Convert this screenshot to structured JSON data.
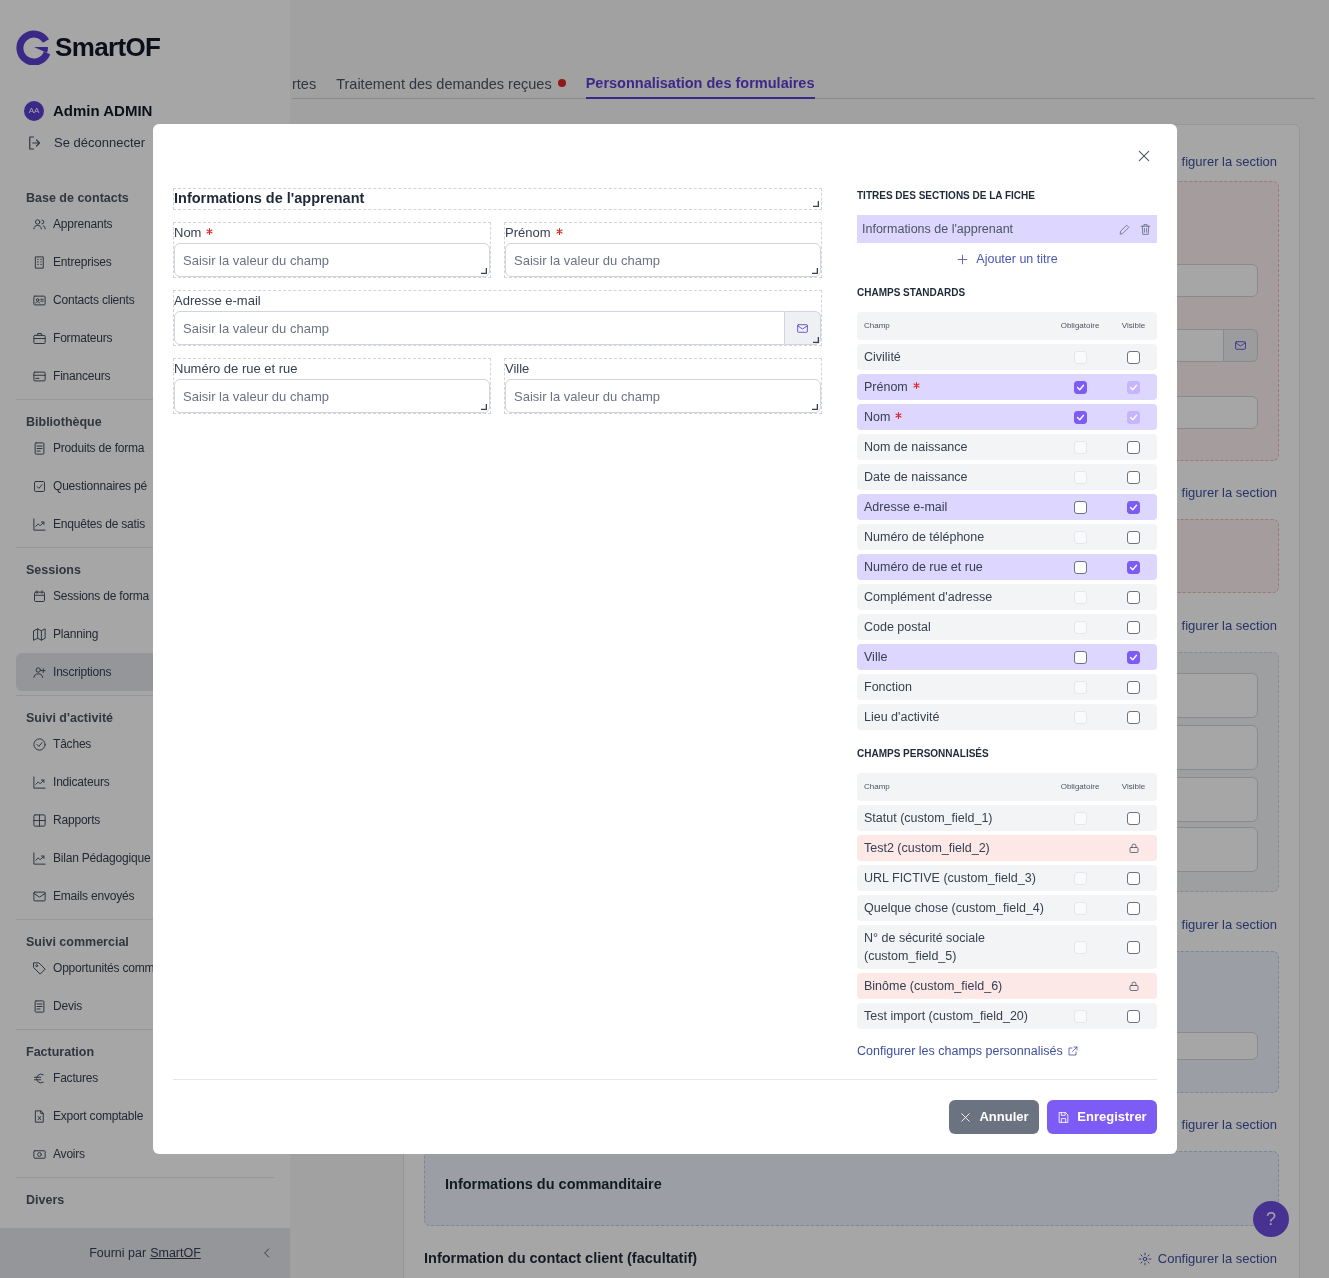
{
  "sidebar": {
    "logo": "SmartOF",
    "user": {
      "initials": "AA",
      "name": "Admin ADMIN"
    },
    "logout": "Se déconnecter",
    "groups": [
      {
        "title": "Base de contacts",
        "items": [
          {
            "label": "Apprenants",
            "selected": false
          },
          {
            "label": "Entreprises",
            "selected": false
          },
          {
            "label": "Contacts clients",
            "selected": false
          },
          {
            "label": "Formateurs",
            "selected": false
          },
          {
            "label": "Financeurs",
            "selected": false
          }
        ]
      },
      {
        "title": "Bibliothèque",
        "items": [
          {
            "label": "Produits de forma",
            "selected": false
          },
          {
            "label": "Questionnaires pé",
            "selected": false
          },
          {
            "label": "Enquêtes de satis",
            "selected": false
          }
        ]
      },
      {
        "title": "Sessions",
        "items": [
          {
            "label": "Sessions de forma",
            "selected": false
          },
          {
            "label": "Planning",
            "selected": false
          },
          {
            "label": "Inscriptions",
            "selected": true
          }
        ]
      },
      {
        "title": "Suivi d'activité",
        "items": [
          {
            "label": "Tâches",
            "selected": false
          },
          {
            "label": "Indicateurs",
            "selected": false
          },
          {
            "label": "Rapports",
            "selected": false
          },
          {
            "label": "Bilan Pédagogique",
            "selected": false
          },
          {
            "label": "Emails envoyés",
            "selected": false
          }
        ]
      },
      {
        "title": "Suivi commercial",
        "items": [
          {
            "label": "Opportunités comm",
            "selected": false
          },
          {
            "label": "Devis",
            "selected": false
          }
        ]
      },
      {
        "title": "Facturation",
        "items": [
          {
            "label": "Factures",
            "selected": false
          },
          {
            "label": "Export comptable",
            "selected": false
          },
          {
            "label": "Avoirs",
            "selected": false
          }
        ]
      },
      {
        "title": "Divers"
      }
    ],
    "footer": {
      "text": "Fourni par",
      "link": "SmartOF"
    }
  },
  "tabs": [
    {
      "label": "rtes",
      "selected": false,
      "notification": false
    },
    {
      "label": "Traitement des demandes reçues",
      "selected": false,
      "notification": true
    },
    {
      "label": "Personnalisation des formulaires",
      "selected": true,
      "notification": false
    }
  ],
  "background": {
    "sections": [
      {
        "link": "figurer la section",
        "kind": "error"
      },
      {
        "link": "figurer la section",
        "kind": "error"
      },
      {
        "link": "figurer la section",
        "kind": "neutral"
      },
      {
        "link": "figurer la section",
        "kind": "info"
      },
      {
        "link": "figurer la section",
        "kind": "info",
        "box_title": "Informations du commanditaire"
      }
    ],
    "last_section": {
      "title": "Information du contact client (facultatif)",
      "link": "Configurer la section"
    },
    "help": "?"
  },
  "modal": {
    "form": {
      "title": "Informations de l'apprenant",
      "fields": [
        {
          "label": "Nom",
          "required": true,
          "placeholder": "Saisir la valeur du champ",
          "kind": "text"
        },
        {
          "label": "Prénom",
          "required": true,
          "placeholder": "Saisir la valeur du champ",
          "kind": "text"
        },
        {
          "label": "Adresse e-mail",
          "required": false,
          "placeholder": "Saisir la valeur du champ",
          "kind": "email"
        },
        {
          "label": "Numéro de rue et rue",
          "required": false,
          "placeholder": "Saisir la valeur du champ",
          "kind": "text"
        },
        {
          "label": "Ville",
          "required": false,
          "placeholder": "Saisir la valeur du champ",
          "kind": "text"
        }
      ]
    },
    "titles_heading": "TITRES DES SECTIONS DE LA FICHE",
    "section_titles": [
      "Informations de l'apprenant"
    ],
    "add_title": "Ajouter un titre",
    "standard": {
      "heading": "CHAMPS STANDARDS",
      "columns": [
        "Champ",
        "Obligatoire",
        "Visible"
      ],
      "rows": [
        {
          "label": "Civilité",
          "required": false,
          "selected": false,
          "mandatory": {
            "checked": false,
            "disabled": true
          },
          "visible": {
            "checked": false,
            "disabled": false
          }
        },
        {
          "label": "Prénom",
          "required": true,
          "selected": true,
          "mandatory": {
            "checked": true,
            "disabled": false
          },
          "visible": {
            "checked": true,
            "disabled": true
          }
        },
        {
          "label": "Nom",
          "required": true,
          "selected": true,
          "mandatory": {
            "checked": true,
            "disabled": false
          },
          "visible": {
            "checked": true,
            "disabled": true
          }
        },
        {
          "label": "Nom de naissance",
          "required": false,
          "selected": false,
          "mandatory": {
            "checked": false,
            "disabled": true
          },
          "visible": {
            "checked": false,
            "disabled": false
          }
        },
        {
          "label": "Date de naissance",
          "required": false,
          "selected": false,
          "mandatory": {
            "checked": false,
            "disabled": true
          },
          "visible": {
            "checked": false,
            "disabled": false
          }
        },
        {
          "label": "Adresse e-mail",
          "required": false,
          "selected": true,
          "mandatory": {
            "checked": false,
            "disabled": false
          },
          "visible": {
            "checked": true,
            "disabled": false
          }
        },
        {
          "label": "Numéro de téléphone",
          "required": false,
          "selected": false,
          "mandatory": {
            "checked": false,
            "disabled": true
          },
          "visible": {
            "checked": false,
            "disabled": false
          }
        },
        {
          "label": "Numéro de rue et rue",
          "required": false,
          "selected": true,
          "mandatory": {
            "checked": false,
            "disabled": false
          },
          "visible": {
            "checked": true,
            "disabled": false
          }
        },
        {
          "label": "Complément d'adresse",
          "required": false,
          "selected": false,
          "mandatory": {
            "checked": false,
            "disabled": true
          },
          "visible": {
            "checked": false,
            "disabled": false
          }
        },
        {
          "label": "Code postal",
          "required": false,
          "selected": false,
          "mandatory": {
            "checked": false,
            "disabled": true
          },
          "visible": {
            "checked": false,
            "disabled": false
          }
        },
        {
          "label": "Ville",
          "required": false,
          "selected": true,
          "mandatory": {
            "checked": false,
            "disabled": false
          },
          "visible": {
            "checked": true,
            "disabled": false
          }
        },
        {
          "label": "Fonction",
          "required": false,
          "selected": false,
          "mandatory": {
            "checked": false,
            "disabled": true
          },
          "visible": {
            "checked": false,
            "disabled": false
          }
        },
        {
          "label": "Lieu d'activité",
          "required": false,
          "selected": false,
          "mandatory": {
            "checked": false,
            "disabled": true
          },
          "visible": {
            "checked": false,
            "disabled": false
          }
        }
      ]
    },
    "custom": {
      "heading": "CHAMPS PERSONNALISÉS",
      "columns": [
        "Champ",
        "Obligatoire",
        "Visible"
      ],
      "rows": [
        {
          "label": "Statut (custom_field_1)",
          "kind": "checkbox",
          "mandatory": {
            "checked": false,
            "disabled": true
          },
          "visible": {
            "checked": false,
            "disabled": false
          }
        },
        {
          "label": "Test2 (custom_field_2)",
          "kind": "locked"
        },
        {
          "label": "URL FICTIVE (custom_field_3)",
          "kind": "checkbox",
          "mandatory": {
            "checked": false,
            "disabled": true
          },
          "visible": {
            "checked": false,
            "disabled": false
          }
        },
        {
          "label": "Quelque chose (custom_field_4)",
          "kind": "checkbox",
          "mandatory": {
            "checked": false,
            "disabled": true
          },
          "visible": {
            "checked": false,
            "disabled": false
          }
        },
        {
          "label": "N° de sécurité sociale (custom_field_5)",
          "kind": "checkbox",
          "mandatory": {
            "checked": false,
            "disabled": true
          },
          "visible": {
            "checked": false,
            "disabled": false
          }
        },
        {
          "label": "Binôme (custom_field_6)",
          "kind": "locked"
        },
        {
          "label": "Test import (custom_field_20)",
          "kind": "checkbox",
          "mandatory": {
            "checked": false,
            "disabled": true
          },
          "visible": {
            "checked": false,
            "disabled": false
          }
        }
      ],
      "config_link": "Configurer les champs personnalisés"
    },
    "buttons": {
      "cancel": "Annuler",
      "save": "Enregistrer"
    }
  }
}
